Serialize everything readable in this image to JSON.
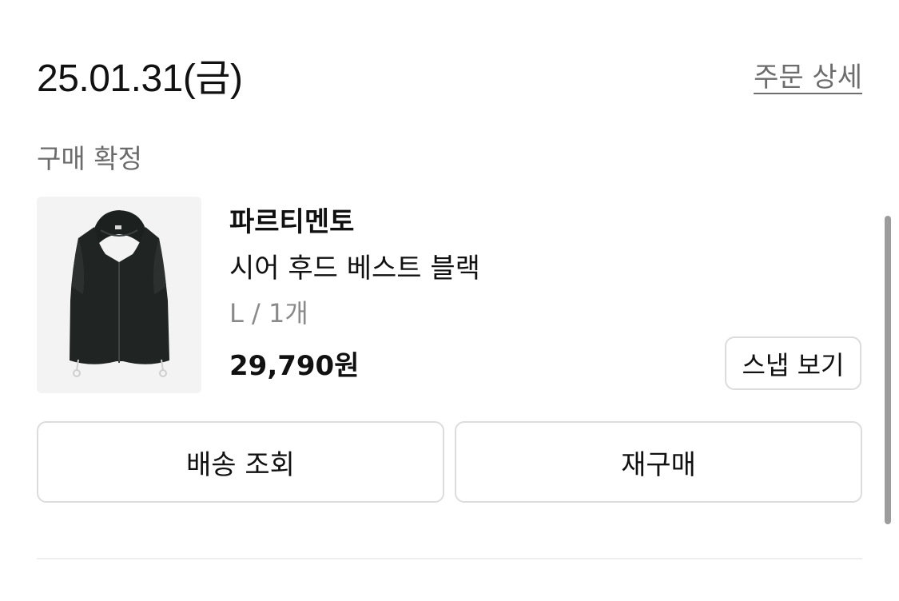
{
  "order": {
    "date": "25.01.31(금)",
    "detail_link": "주문 상세",
    "status": "구매 확정"
  },
  "product": {
    "brand": "파르티멘토",
    "name": "시어 후드 베스트 블랙",
    "option": "L / 1개",
    "price": "29,790원",
    "image_icon": "hooded-vest-black",
    "snap_button": "스냅 보기"
  },
  "actions": {
    "track_delivery": "배송 조회",
    "reorder": "재구매"
  }
}
